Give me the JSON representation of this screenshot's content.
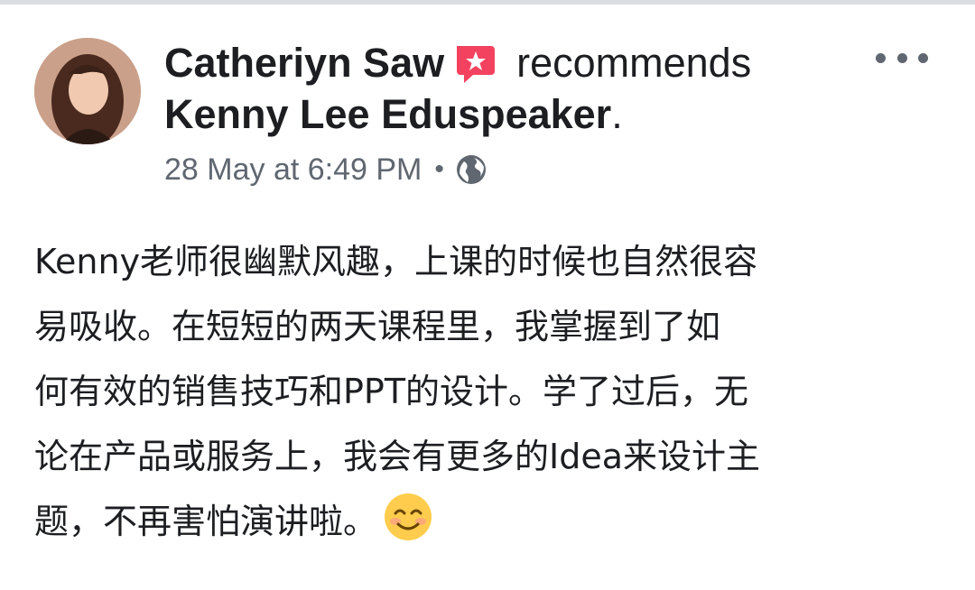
{
  "post": {
    "author_name": "Catheriyn Saw",
    "recommends_text": "recommends",
    "page_name": "Kenny Lee Eduspeaker",
    "page_name_suffix": ".",
    "timestamp": "28 May at 6:49 PM",
    "separator": "•",
    "privacy_icon": "globe-icon",
    "recommend_icon": "recommendation-star-icon",
    "more_icon": "more-options-icon",
    "body_lines": [
      "Kenny老师很幽默风趣，上课的时候也自然很容",
      "易吸收。在短短的两天课程里，我掌握到了如",
      "何有效的销售技巧和PPT的设计。学了过后，无",
      "论在产品或服务上，我会有更多的Idea来设计主",
      "题，不再害怕演讲啦。"
    ],
    "body_emoji": "smiling-face-emoji"
  },
  "colors": {
    "text_primary": "#1c1e21",
    "text_secondary": "#606770",
    "recommend_icon": "#f3425f"
  }
}
